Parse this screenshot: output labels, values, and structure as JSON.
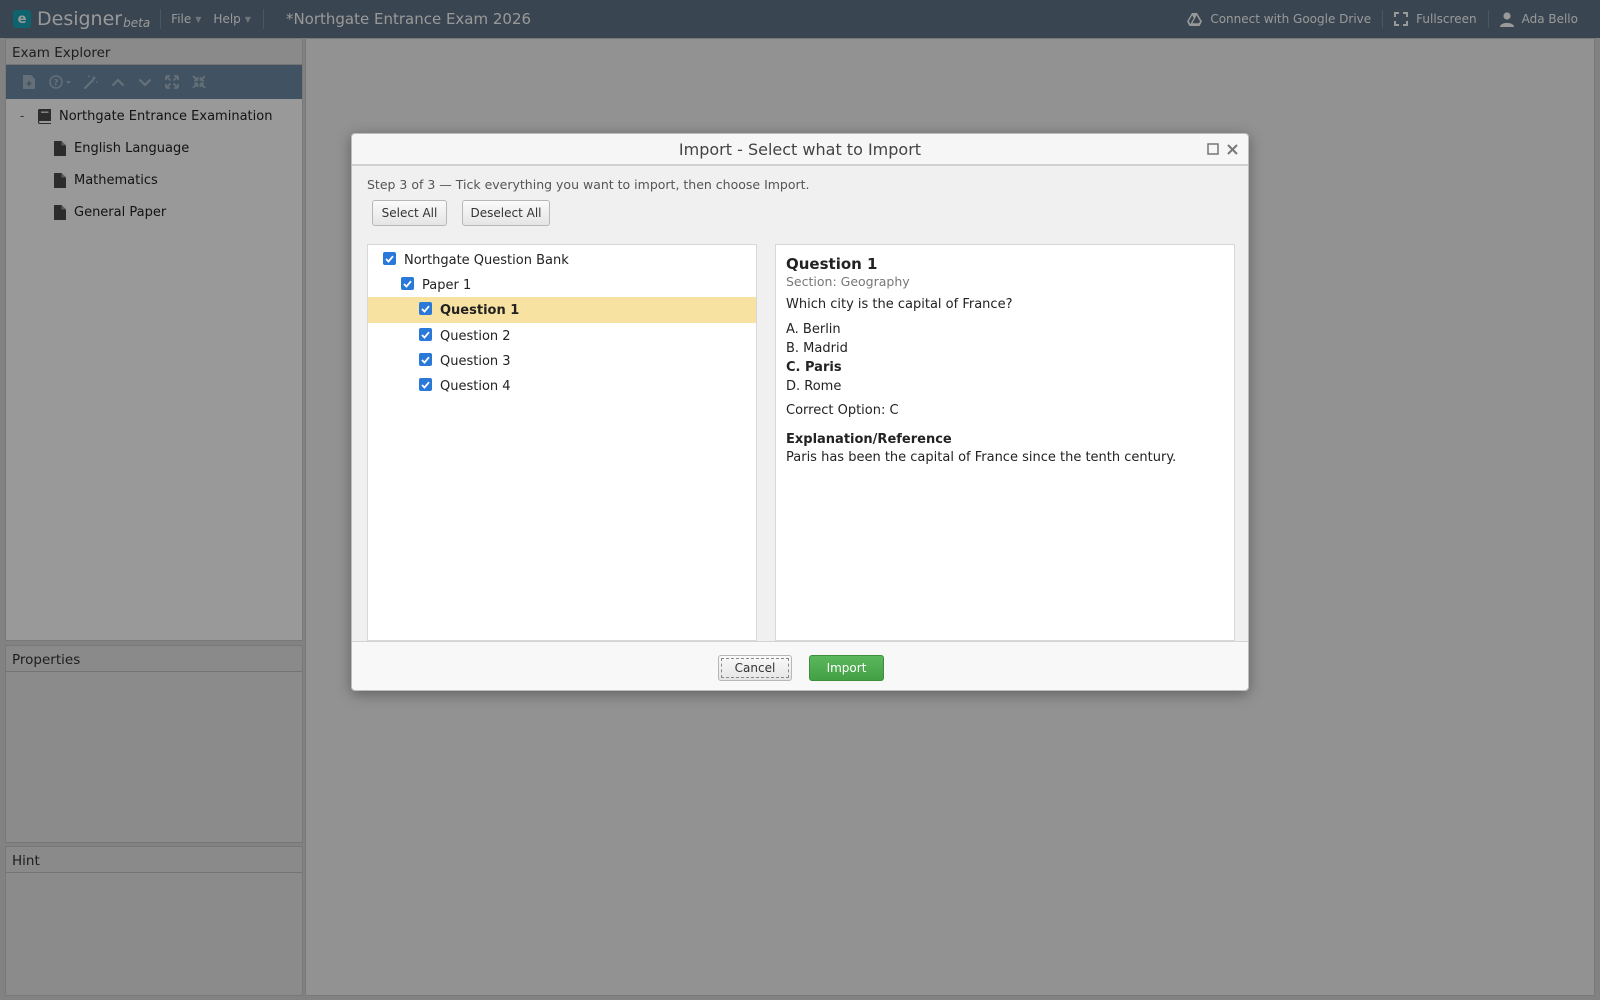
{
  "app": {
    "name": "Designer",
    "badge": "beta",
    "logo_letter": "e"
  },
  "menu": [
    {
      "label": "File"
    },
    {
      "label": "Help"
    }
  ],
  "document_title": "*Northgate Entrance Exam 2026",
  "topbar_right": {
    "drive": "Connect with Google Drive",
    "fullscreen": "Fullscreen",
    "user": "Ada Bello"
  },
  "explorer": {
    "title": "Exam Explorer",
    "root": "Northgate Entrance Examination",
    "collapse_symbol": "-",
    "items": [
      {
        "label": "English Language"
      },
      {
        "label": "Mathematics"
      },
      {
        "label": "General Paper"
      }
    ]
  },
  "properties": {
    "title": "Properties"
  },
  "hint": {
    "title": "Hint"
  },
  "dialog": {
    "title": "Import - Select what to Import",
    "step": "Step 3 of 3 — Tick everything you want to import, then choose Import.",
    "select_all": "Select All",
    "deselect_all": "Deselect All",
    "tree": {
      "bank": "Northgate Question Bank",
      "paper": "Paper 1",
      "questions": [
        {
          "label": "Question 1",
          "checked": true
        },
        {
          "label": "Question 2",
          "checked": true
        },
        {
          "label": "Question 3",
          "checked": true
        },
        {
          "label": "Question 4",
          "checked": true
        }
      ]
    },
    "preview": {
      "title": "Question 1",
      "section": "Section: Geography",
      "text": "Which city is the capital of France?",
      "options": [
        {
          "label": "A. Berlin",
          "correct": false
        },
        {
          "label": "B. Madrid",
          "correct": false
        },
        {
          "label": "C. Paris",
          "correct": true
        },
        {
          "label": "D. Rome",
          "correct": false
        }
      ],
      "correct_option": "Correct Option: C",
      "explanation_heading": "Explanation/Reference",
      "explanation": "Paris has been the capital of France since the tenth century."
    },
    "cancel": "Cancel",
    "import": "Import"
  },
  "colors": {
    "topbar": "#5f7387",
    "toolbar": "#6d8aa6",
    "accent": "#1aa6b7",
    "selection": "#f8e2a2",
    "checkbox": "#2a78d8",
    "import_button": "#4ca94c"
  }
}
